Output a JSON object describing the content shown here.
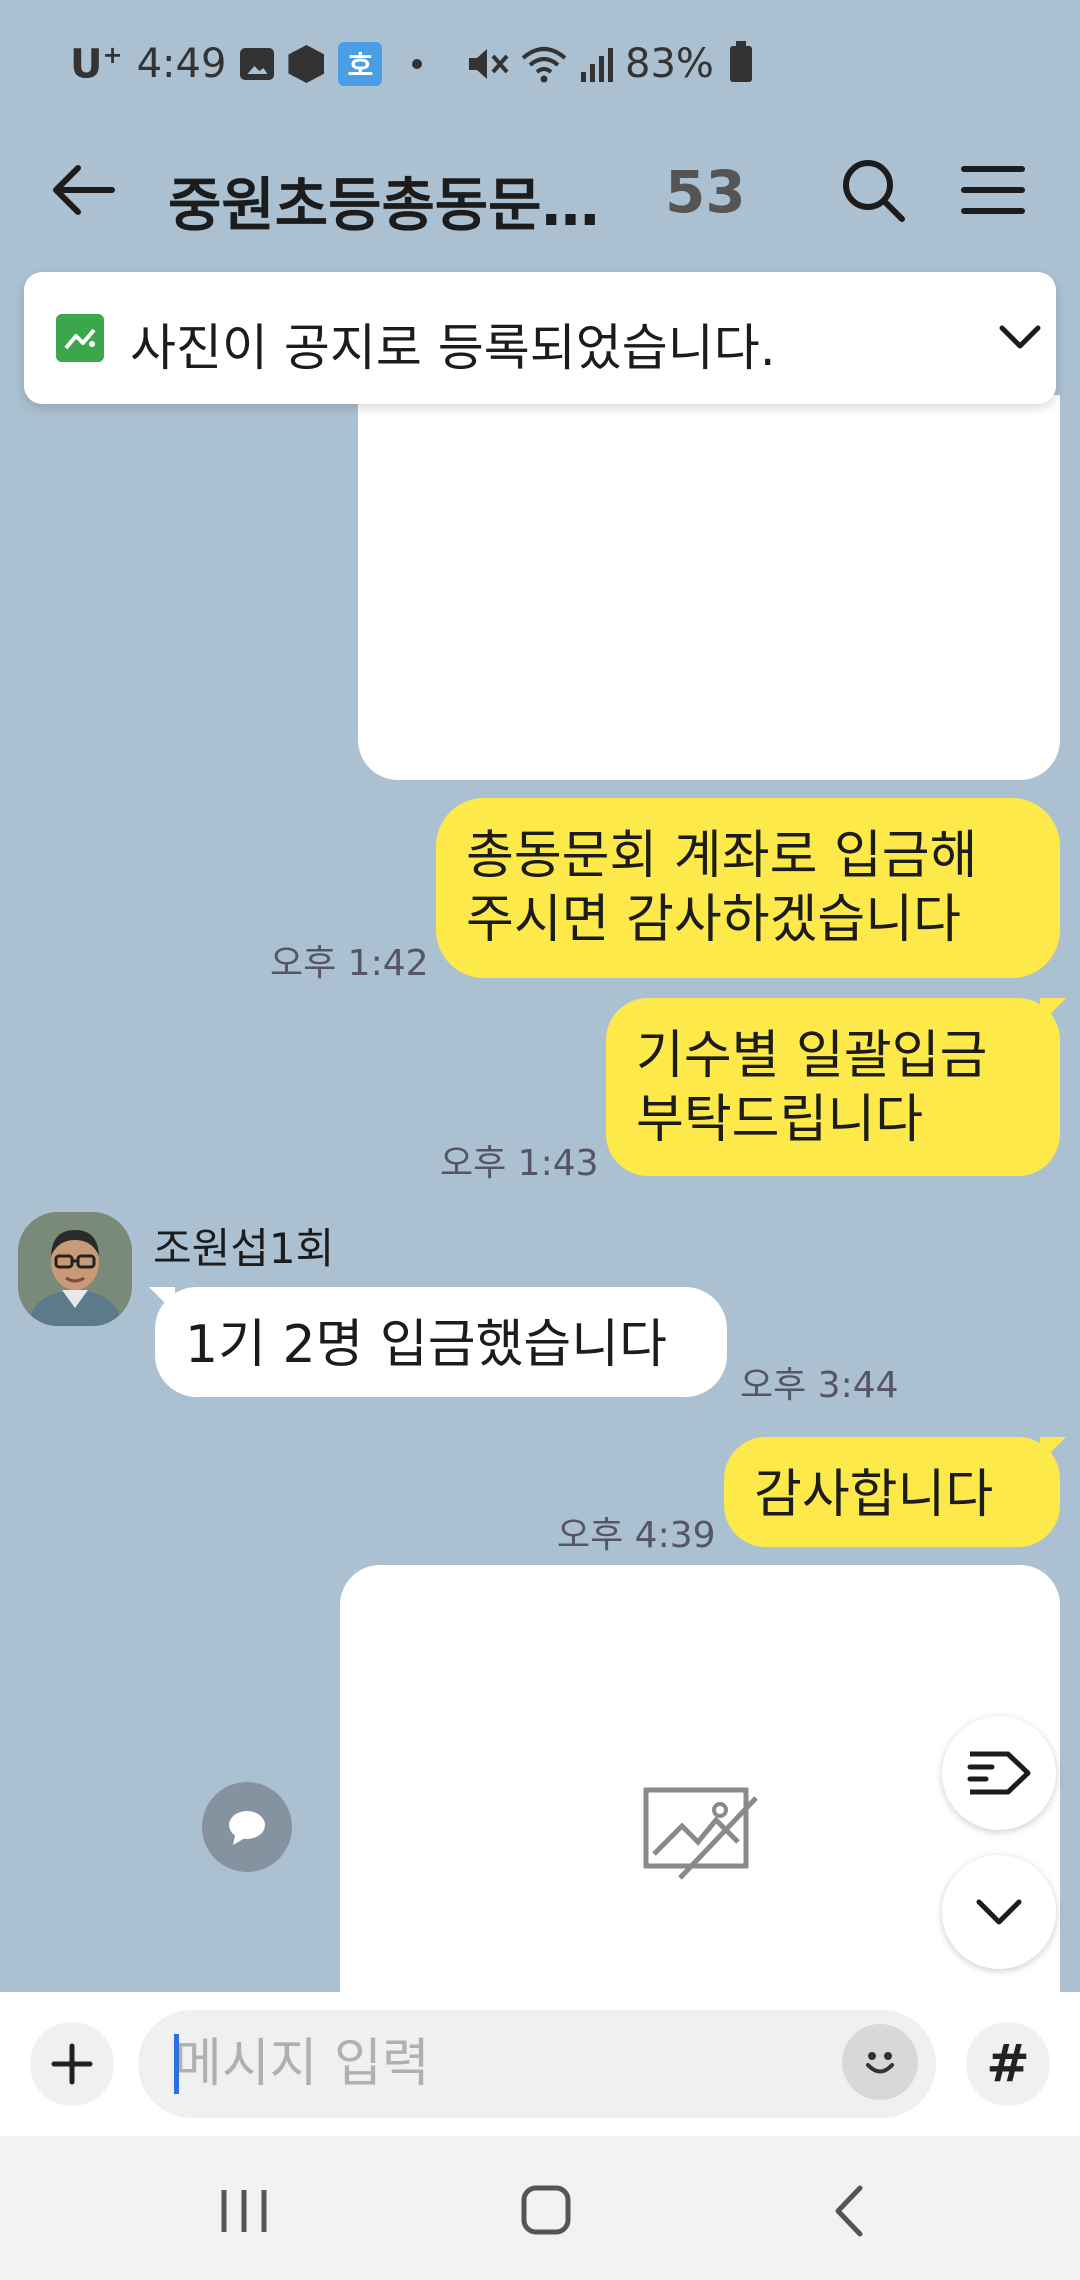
{
  "status_bar": {
    "carrier": "U",
    "carrier_sup": "+",
    "time": "4:49",
    "ho_icon_text": "호",
    "battery": "83%"
  },
  "header": {
    "title": "중원초등총동문…",
    "member_count": "53"
  },
  "notice": {
    "text": "사진이 공지로 등록되었습니다."
  },
  "messages": [
    {
      "type": "text",
      "mine": true,
      "line1": "총동문회 계좌로 입금해",
      "line2": "주시면 감사하겠습니다",
      "time": "오후 1:42"
    },
    {
      "type": "text",
      "mine": true,
      "line1": "기수별 일괄입금",
      "line2": "부탁드립니다",
      "time": "오후 1:43"
    },
    {
      "type": "text",
      "mine": false,
      "sender": "조원섭1회",
      "text": "1기 2명 입금했습니다",
      "time": "오후 3:44"
    },
    {
      "type": "text",
      "mine": true,
      "text": "감사합니다",
      "time": "오후 4:39"
    }
  ],
  "input": {
    "placeholder": "메시지 입력",
    "hash_label": "#"
  },
  "icons": {
    "back": "arrow-left-icon",
    "search": "search-icon",
    "menu": "hamburger-icon",
    "notice": "image-icon",
    "chevron": "chevron-down-icon",
    "broken_image": "broken-image-icon",
    "reply": "speech-bubble-icon",
    "tag": "tag-icon",
    "scroll_down": "chevron-down-icon",
    "plus": "plus-icon",
    "emoji": "emoji-icon"
  },
  "colors": {
    "chat_background": "#abc1d1",
    "my_bubble": "#fde94a",
    "their_bubble": "#ffffff",
    "notice_icon": "#3ca64a"
  }
}
